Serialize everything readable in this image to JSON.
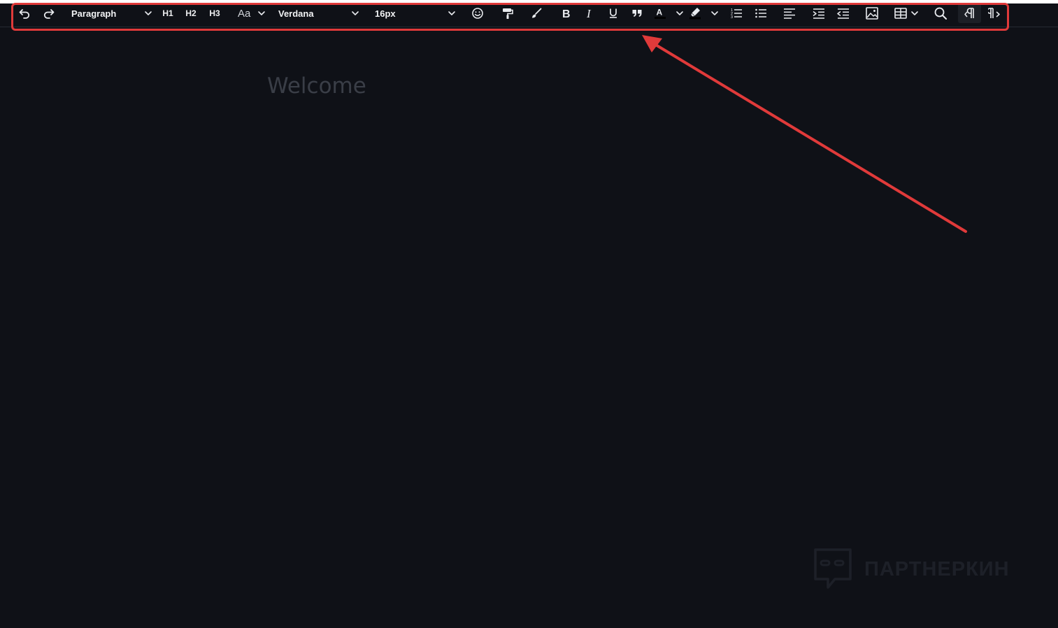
{
  "toolbar": {
    "paragraph_label": "Paragraph",
    "h1": "H1",
    "h2": "H2",
    "h3": "H3",
    "case_label": "Aa",
    "font_family": "Verdana",
    "font_size": "16px",
    "icons": [
      "undo-icon",
      "redo-icon",
      "chevron-down-icon",
      "emoji-icon",
      "format-painter-icon",
      "clear-format-icon",
      "bold-icon",
      "italic-icon",
      "underline-icon",
      "quote-icon",
      "text-color-icon",
      "highlight-icon",
      "ordered-list-icon",
      "bullet-list-icon",
      "align-left-icon",
      "indent-icon",
      "outdent-icon",
      "image-icon",
      "table-icon",
      "search-icon",
      "ltr-icon",
      "rtl-icon"
    ]
  },
  "editor": {
    "placeholder": "Welcome"
  },
  "watermark": {
    "text": "ПАРТНЕРКИН"
  },
  "colors": {
    "background": "#0f1117",
    "annotation": "#e03a3a",
    "toolbar_text": "#f1f2f4",
    "placeholder": "#3a3e47"
  }
}
